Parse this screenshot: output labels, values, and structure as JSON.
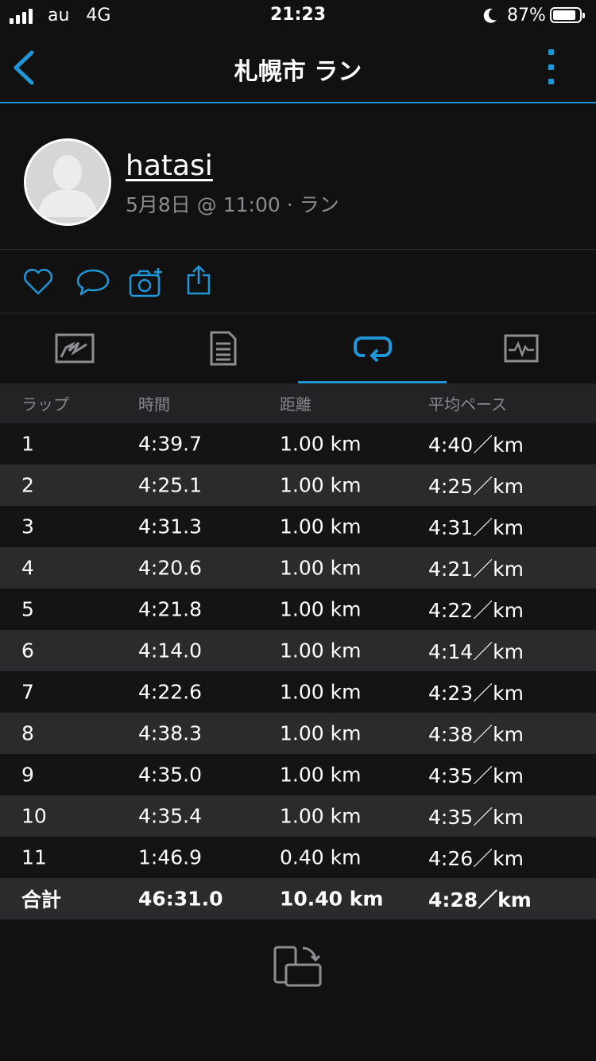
{
  "status_bar": {
    "carrier": "au",
    "network": "4G",
    "time": "21:23",
    "battery": "87%"
  },
  "nav": {
    "title": "札幌市 ラン",
    "back_icon": "chevron-left-icon",
    "menu_icon": "kebab-menu-icon"
  },
  "activity": {
    "username": "hatasi",
    "meta": "5月8日 @ 11:00 · ラン"
  },
  "actions": [
    "like-icon",
    "comment-icon",
    "add-photo-icon",
    "share-icon"
  ],
  "tabs": [
    "map-tab",
    "details-tab",
    "laps-tab",
    "charts-tab"
  ],
  "laps_table": {
    "headers": [
      "ラップ",
      "時間",
      "距離",
      "平均ペース"
    ],
    "rows": [
      [
        "1",
        "4:39.7",
        "1.00 km",
        "4:40／km"
      ],
      [
        "2",
        "4:25.1",
        "1.00 km",
        "4:25／km"
      ],
      [
        "3",
        "4:31.3",
        "1.00 km",
        "4:31／km"
      ],
      [
        "4",
        "4:20.6",
        "1.00 km",
        "4:21／km"
      ],
      [
        "5",
        "4:21.8",
        "1.00 km",
        "4:22／km"
      ],
      [
        "6",
        "4:14.0",
        "1.00 km",
        "4:14／km"
      ],
      [
        "7",
        "4:22.6",
        "1.00 km",
        "4:23／km"
      ],
      [
        "8",
        "4:38.3",
        "1.00 km",
        "4:38／km"
      ],
      [
        "9",
        "4:35.0",
        "1.00 km",
        "4:35／km"
      ],
      [
        "10",
        "4:35.4",
        "1.00 km",
        "4:35／km"
      ],
      [
        "11",
        "1:46.9",
        "0.40 km",
        "4:26／km"
      ]
    ],
    "total": [
      "合計",
      "46:31.0",
      "10.40 km",
      "4:28／km"
    ]
  },
  "colors": {
    "accent": "#1f96d6",
    "background": "#111112",
    "row_alt": "#2b2b2d",
    "muted_text": "#8b8b90"
  }
}
